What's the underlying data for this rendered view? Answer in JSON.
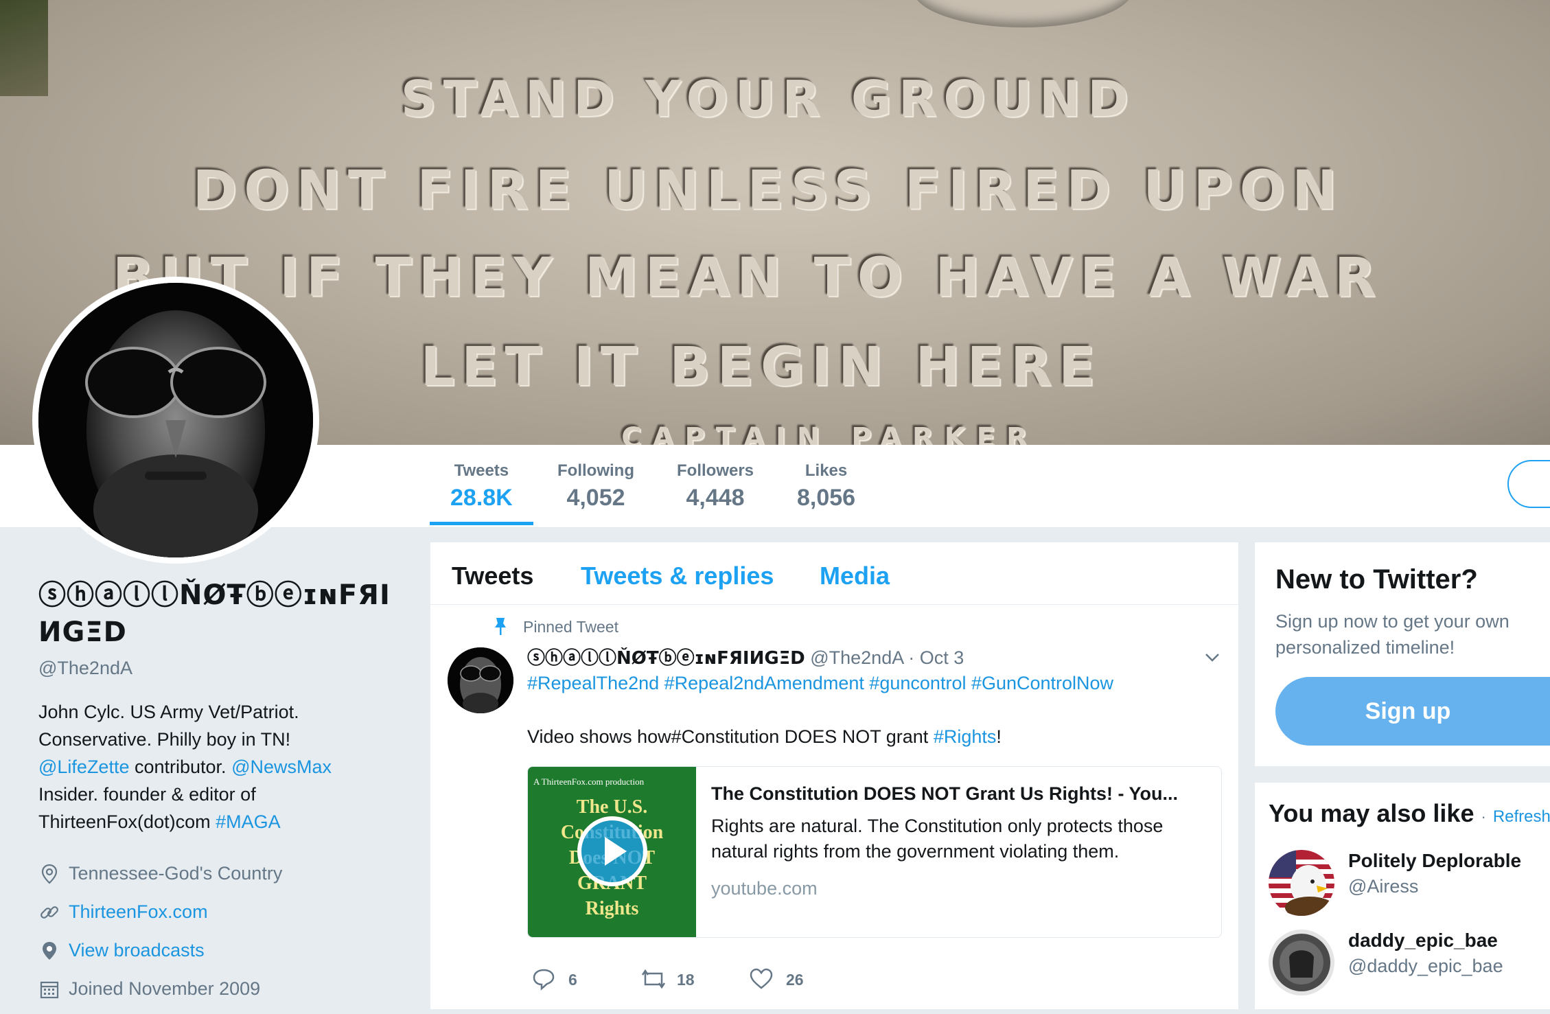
{
  "banner": {
    "lines": [
      "STAND YOUR GROUND",
      "DONT FIRE UNLESS FIRED UPON",
      "BUT IF THEY MEAN TO HAVE A WAR",
      "LET IT BEGIN HERE",
      "CAPTAIN PARKER"
    ]
  },
  "stats": [
    {
      "label": "Tweets",
      "value": "28.8K"
    },
    {
      "label": "Following",
      "value": "4,052"
    },
    {
      "label": "Followers",
      "value": "4,448"
    },
    {
      "label": "Likes",
      "value": "8,056"
    }
  ],
  "profile": {
    "name_line1": "ⓢⓗⓐⓛⓛŇØŦⓑⓔɪɴFЯI",
    "name_line2": "ИGΞD",
    "handle": "@The2ndA",
    "bio": {
      "line1": "John Cylc. US Army Vet/Patriot.",
      "line2": "Conservative. Philly boy in TN!",
      "mention1": "@LifeZette",
      "text3": " contributor. ",
      "mention2": "@NewsMax",
      "line4": "Insider. founder & editor of",
      "text5": "ThirteenFox(dot)com ",
      "hashtag": "#MAGA"
    },
    "location": "Tennessee-God's Country",
    "website": "ThirteenFox.com",
    "broadcasts": "View broadcasts",
    "joined": "Joined November 2009"
  },
  "timeline": {
    "tabs": [
      "Tweets",
      "Tweets & replies",
      "Media"
    ],
    "pinned_label": "Pinned Tweet",
    "tweet": {
      "name": "ⓢⓗⓐⓛⓛŇØŦⓑⓔɪɴFЯIИGΞD",
      "handle": "@The2ndA",
      "date": "· Oct 3",
      "hashtags": "#RepealThe2nd #Repeal2ndAmendment #guncontrol #GunControlNow",
      "text_before": "Video shows how#Constitution DOES NOT grant ",
      "text_link": "#Rights",
      "text_after": "!",
      "card": {
        "title": "The Constitution DOES NOT Grant Us Rights! - You...",
        "description": "Rights are natural. The Constitution only protects those natural rights from the government violating them.",
        "domain": "youtube.com",
        "thumb_top": "A ThirteenFox.com production",
        "thumb_lines": [
          "The U.S.",
          "Constitution",
          "Does NOT",
          "GRANT",
          "Rights"
        ]
      },
      "actions": {
        "replies": "6",
        "retweets": "18",
        "likes": "26"
      }
    }
  },
  "sidebar": {
    "new_title": "New to Twitter?",
    "new_sub": "Sign up now to get your own personalized timeline!",
    "signup_label": "Sign up",
    "wtf_title": "You may also like",
    "wtf_dot": "·",
    "wtf_refresh": "Refresh",
    "suggestions": [
      {
        "name": "Politely Deplorable",
        "handle": "@Airess"
      },
      {
        "name": "daddy_epic_bae",
        "handle": "@daddy_epic_bae"
      }
    ]
  },
  "colors": {
    "accent": "#1da1f2",
    "link": "#1b95e0",
    "muted": "#657786",
    "background": "#e6ecf0"
  }
}
